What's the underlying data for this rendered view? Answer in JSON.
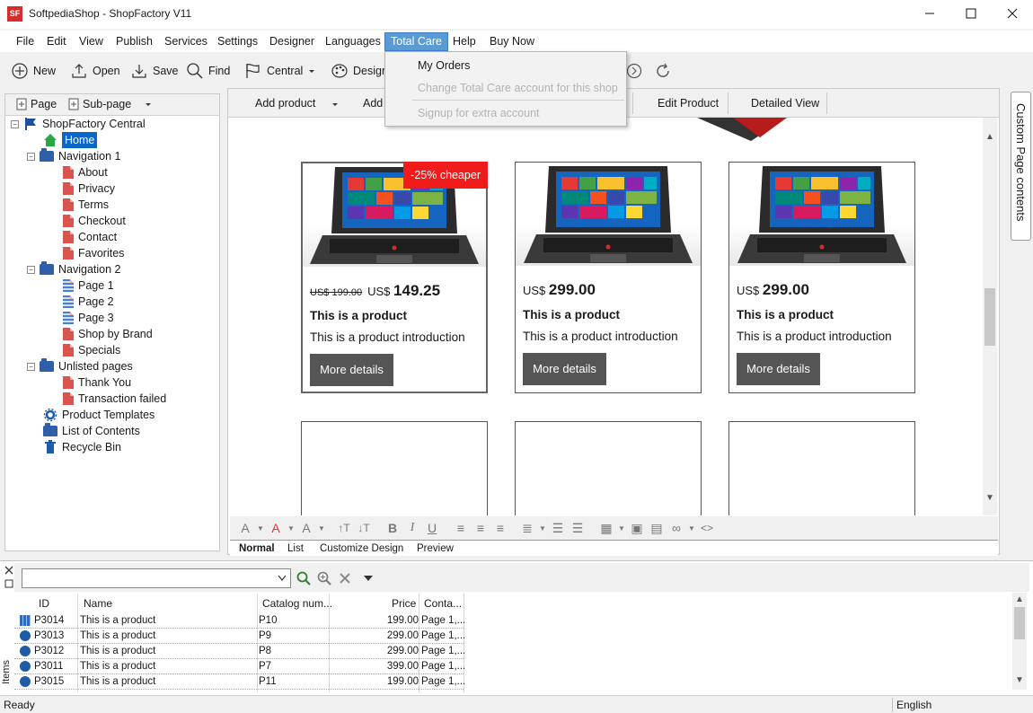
{
  "window": {
    "title": "SoftpediaShop - ShopFactory V11",
    "icon_text": "SF"
  },
  "menubar": [
    "File",
    "Edit",
    "View",
    "Publish",
    "Services",
    "Settings",
    "Designer",
    "Languages",
    "Total Care",
    "Help",
    "Buy Now"
  ],
  "toolbar": {
    "new": "New",
    "open": "Open",
    "save": "Save",
    "find": "Find",
    "central": "Central",
    "design": "Design"
  },
  "dropdown": {
    "my_orders": "My Orders",
    "change_account": "Change Total Care account for this shop",
    "signup": "Signup for extra account"
  },
  "left_tabs": {
    "page": "Page",
    "subpage": "Sub-page"
  },
  "tree": [
    {
      "label": "ShopFactory Central"
    },
    {
      "label": "Home"
    },
    {
      "label": "Navigation 1"
    },
    {
      "label": "About"
    },
    {
      "label": "Privacy"
    },
    {
      "label": "Terms"
    },
    {
      "label": "Checkout"
    },
    {
      "label": "Contact"
    },
    {
      "label": "Favorites"
    },
    {
      "label": "Navigation 2"
    },
    {
      "label": "Page 1"
    },
    {
      "label": "Page 2"
    },
    {
      "label": "Page 3"
    },
    {
      "label": "Shop by Brand"
    },
    {
      "label": "Specials"
    },
    {
      "label": "Unlisted pages"
    },
    {
      "label": "Thank You"
    },
    {
      "label": "Transaction failed"
    },
    {
      "label": "Product Templates"
    },
    {
      "label": "List of Contents"
    },
    {
      "label": "Recycle Bin"
    }
  ],
  "editor_toolbar": {
    "add_product": "Add product",
    "add": "Add",
    "edit_product": "Edit Product",
    "detailed_view": "Detailed View"
  },
  "products": [
    {
      "old_price": "US$ 199.00",
      "currency": "US$",
      "price": "149.25",
      "name": "This is a product",
      "intro": "This is a product introduction",
      "button": "More details",
      "badge": "-25% cheaper"
    },
    {
      "currency": "US$",
      "price": "299.00",
      "name": "This is a product",
      "intro": "This is a product introduction",
      "button": "More details"
    },
    {
      "currency": "US$",
      "price": "299.00",
      "name": "This is a product",
      "intro": "This is a product introduction",
      "button": "More details"
    }
  ],
  "view_tabs": [
    "Normal",
    "List",
    "Customize Design",
    "Preview"
  ],
  "side_tab": "Custom Page contents",
  "grid": {
    "headers": [
      "ID",
      "Name",
      "Catalog num...",
      "Price",
      "Conta..."
    ],
    "rows": [
      [
        "P3014",
        "This is a product",
        "P10",
        "199.00",
        "Page 1,..."
      ],
      [
        "P3013",
        "This is a product",
        "P9",
        "299.00",
        "Page 1,..."
      ],
      [
        "P3012",
        "This is a product",
        "P8",
        "299.00",
        "Page 1,..."
      ],
      [
        "P3011",
        "This is a product",
        "P7",
        "399.00",
        "Page 1,..."
      ],
      [
        "P3015",
        "This is a product",
        "P11",
        "199.00",
        "Page 1,..."
      ]
    ],
    "items_label": "Items"
  },
  "status": {
    "left": "Ready",
    "right": "English"
  },
  "colors": {
    "accent": "#5b9bd5",
    "badge": "#f21b1b",
    "button": "#555555",
    "selection": "#0b67c7"
  }
}
